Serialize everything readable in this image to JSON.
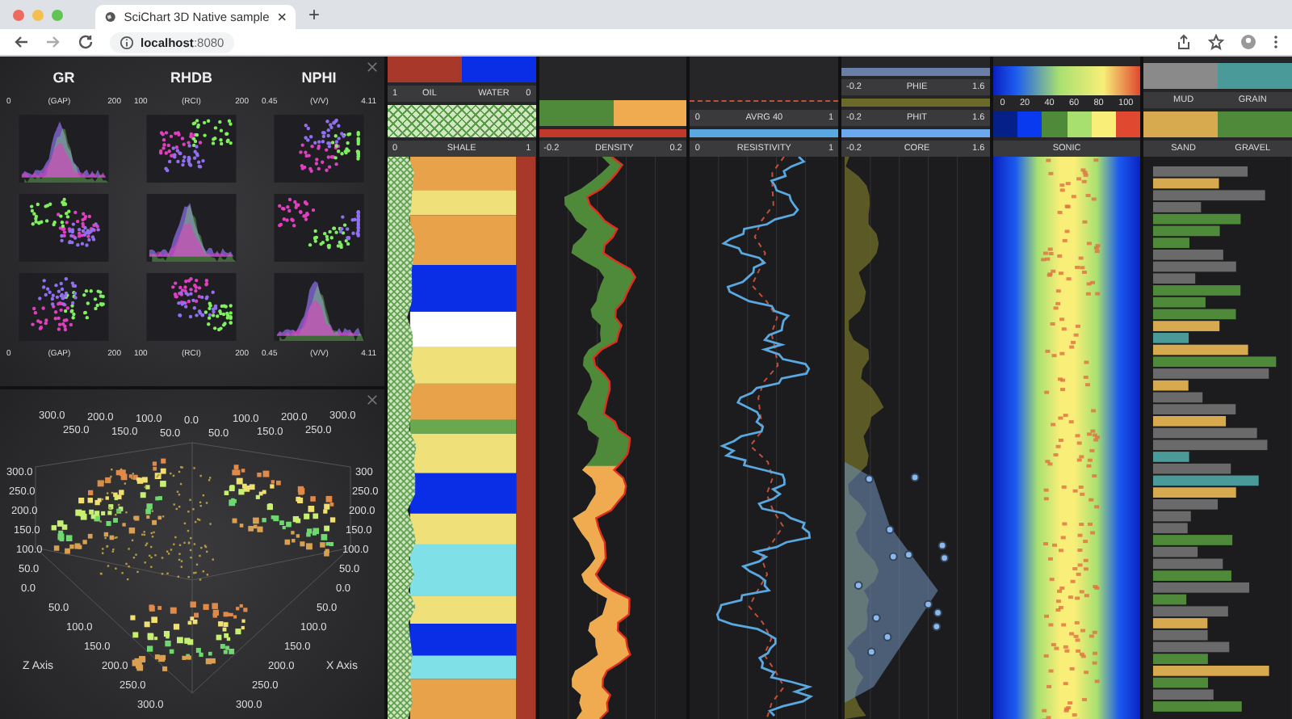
{
  "browser": {
    "tab_title": "SciChart 3D Native sample",
    "new_tab": "+",
    "url_host": "localhost",
    "url_port": ":8080"
  },
  "scatter_matrix": {
    "columns": [
      {
        "title": "GR",
        "min": "0",
        "unit": "(GAP)",
        "max": "200"
      },
      {
        "title": "RHDB",
        "min": "100",
        "unit": "(RCI)",
        "max": "200"
      },
      {
        "title": "NPHI",
        "min": "0.45",
        "unit": "(V/V)",
        "max": "4.11"
      }
    ],
    "bottom_axes": [
      {
        "min": "0",
        "unit": "(GAP)",
        "max": "200"
      },
      {
        "min": "100",
        "unit": "(RCI)",
        "max": "200"
      },
      {
        "min": "0.45",
        "unit": "(V/V)",
        "max": "4.11"
      }
    ]
  },
  "chart_3d": {
    "top_ticks": [
      "300.0",
      "250.0",
      "200.0",
      "150.0",
      "100.0",
      "50.0",
      "0.0",
      "50.0",
      "100.0",
      "150.0",
      "200.0",
      "250.0",
      "300.0"
    ],
    "left_ticks": [
      "300.0",
      "250.0",
      "200.0",
      "150.0",
      "100.0",
      "50.0",
      "0.0"
    ],
    "right_ticks": [
      "300",
      "250.0",
      "200.0",
      "150.0",
      "100.0",
      "50.0",
      "0.0"
    ],
    "z_ticks": [
      "50.0",
      "100.0",
      "150.0",
      "200.0",
      "250.0",
      "300.0"
    ],
    "x_ticks": [
      "50.0",
      "100.0",
      "150.0",
      "200.0",
      "250.0",
      "300.0"
    ],
    "z_axis_title": "Z Axis",
    "x_axis_title": "X Axis"
  },
  "tracks": [
    {
      "kind": "lithology",
      "header": [
        {
          "kind": "swatches",
          "items": [
            {
              "color": "#a8382a"
            },
            {
              "color": "#0a2ee6"
            }
          ]
        },
        {
          "kind": "scale",
          "min": "1",
          "labels": [
            "OIL",
            "WATER"
          ],
          "max": "0"
        },
        {
          "kind": "pattern"
        },
        {
          "kind": "scale",
          "min": "0",
          "labels": [
            "SHALE"
          ],
          "max": "1"
        }
      ]
    },
    {
      "kind": "density",
      "header": [
        {
          "kind": "swatches",
          "items": [
            {
              "color": "#4f8a3a"
            },
            {
              "color": "#f0aa50"
            }
          ]
        },
        {
          "kind": "line",
          "color": "#c0392b"
        },
        {
          "kind": "scale",
          "min": "-0.2",
          "labels": [
            "DENSITY"
          ],
          "max": "0.2"
        }
      ]
    },
    {
      "kind": "resistivity",
      "header": [
        {
          "kind": "dashed_line",
          "color": "#c0503a"
        },
        {
          "kind": "scale",
          "min": "0",
          "labels": [
            "AVRG 40"
          ],
          "max": "1"
        },
        {
          "kind": "line",
          "color": "#5aa8e0"
        },
        {
          "kind": "scale",
          "min": "0",
          "labels": [
            "RESISTIVITY"
          ],
          "max": "1"
        }
      ]
    },
    {
      "kind": "porosity",
      "header": [
        {
          "kind": "line",
          "color": "#6a7fa8"
        },
        {
          "kind": "scale",
          "min": "-0.2",
          "labels": [
            "PHIE"
          ],
          "max": "1.6"
        },
        {
          "kind": "line",
          "color": "#6b6a28"
        },
        {
          "kind": "scale",
          "min": "-0.2",
          "labels": [
            "PHIT"
          ],
          "max": "1.6"
        },
        {
          "kind": "line",
          "color": "#6aa8f0"
        },
        {
          "kind": "scale",
          "min": "-0.2",
          "labels": [
            "CORE"
          ],
          "max": "1.6"
        }
      ]
    },
    {
      "kind": "sonic",
      "header": [
        {
          "kind": "gradient"
        },
        {
          "kind": "ticks",
          "labels": [
            "0",
            "20",
            "40",
            "60",
            "80",
            "100"
          ]
        },
        {
          "kind": "swatches",
          "items": [
            {
              "color": "#06208a"
            },
            {
              "color": "#0a3af0"
            },
            {
              "color": "#4f8a3a"
            },
            {
              "color": "#a8e070"
            },
            {
              "color": "#f8ee78"
            },
            {
              "color": "#e04830"
            }
          ]
        },
        {
          "kind": "scale",
          "labels": [
            "SONIC"
          ]
        }
      ]
    },
    {
      "kind": "bars",
      "header": [
        {
          "kind": "swatches",
          "items": [
            {
              "color": "#8a8a8a"
            },
            {
              "color": "#4a9a9a"
            }
          ]
        },
        {
          "kind": "scale",
          "labels": [
            "MUD",
            "GRAIN"
          ]
        },
        {
          "kind": "swatches",
          "items": [
            {
              "color": "#d8aa50"
            },
            {
              "color": "#4f8a3a"
            }
          ]
        },
        {
          "kind": "scale",
          "labels": [
            "SAND",
            "GRAVEL"
          ]
        }
      ]
    }
  ]
}
